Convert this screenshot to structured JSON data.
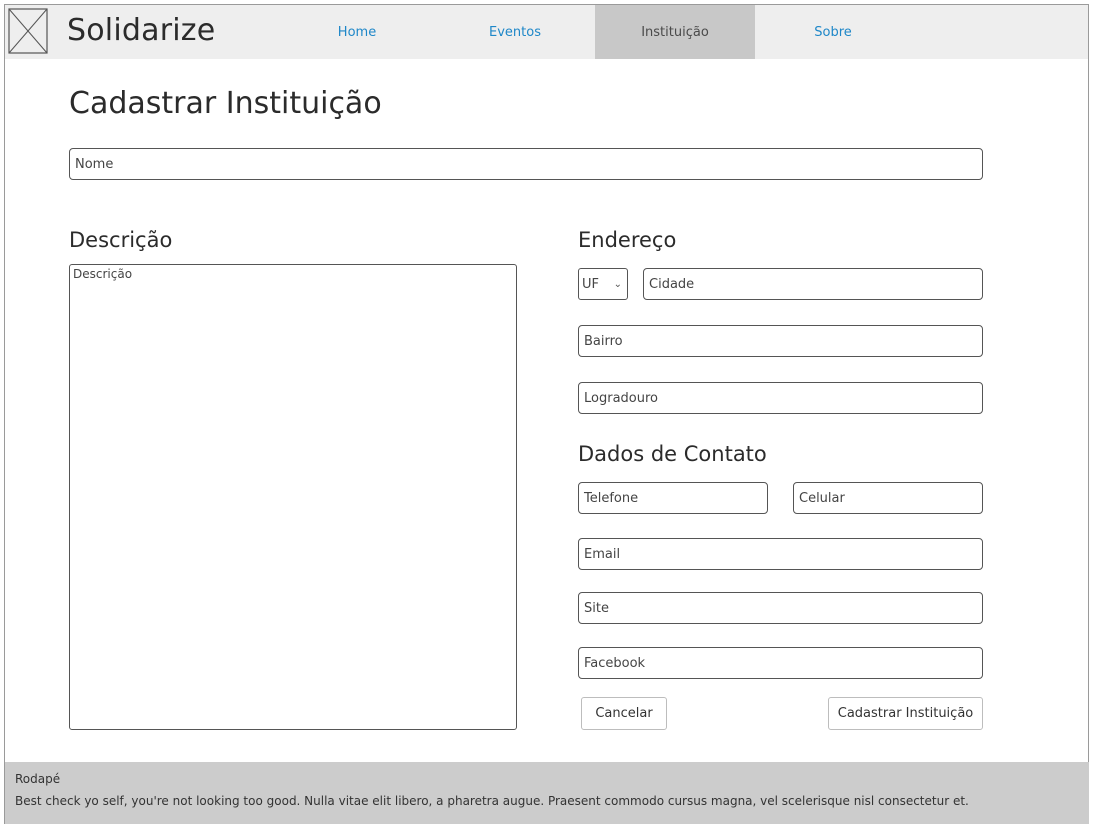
{
  "header": {
    "brand": "Solidarize",
    "nav": [
      {
        "label": "Home"
      },
      {
        "label": "Eventos"
      },
      {
        "label": "Instituição"
      },
      {
        "label": "Sobre"
      }
    ]
  },
  "form": {
    "title": "Cadastrar Instituição",
    "nome_placeholder": "Nome",
    "descricao_heading": "Descrição",
    "descricao_placeholder": "Descrição",
    "endereco_heading": "Endereço",
    "uf_value": "UF",
    "cidade_placeholder": "Cidade",
    "bairro_placeholder": "Bairro",
    "logradouro_placeholder": "Logradouro",
    "contato_heading": "Dados de Contato",
    "telefone_placeholder": "Telefone",
    "celular_placeholder": "Celular",
    "email_placeholder": "Email",
    "site_placeholder": "Site",
    "facebook_placeholder": "Facebook",
    "cancel_label": "Cancelar",
    "submit_label": "Cadastrar Instituição"
  },
  "footer": {
    "title": "Rodapé",
    "text": "Best check yo self, you're not looking too good. Nulla vitae elit libero, a pharetra augue. Praesent commodo cursus magna, vel scelerisque nisl consectetur et."
  },
  "colors": {
    "header_bg": "#eeeeee",
    "nav_link": "#1e87c8",
    "nav_active_bg": "#c8c8c8",
    "footer_bg": "#cccccc"
  }
}
